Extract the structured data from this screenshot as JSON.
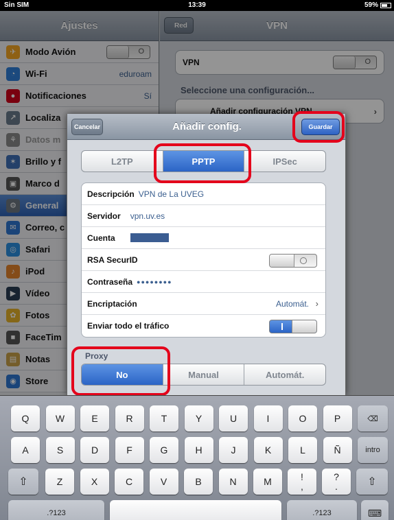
{
  "status_bar": {
    "carrier": "Sin SIM",
    "time": "13:39",
    "battery": "59%"
  },
  "master": {
    "title": "Ajustes",
    "items": [
      {
        "label": "Modo Avión",
        "icon": "airplane-icon",
        "color": "#f5a623",
        "toggle": "O"
      },
      {
        "label": "Wi-Fi",
        "icon": "wifi-icon",
        "color": "#2f7fd8",
        "value": "eduroam"
      },
      {
        "label": "Notificaciones",
        "icon": "notifications-icon",
        "color": "#d0021b",
        "value": "Sí"
      },
      {
        "label": "Localiza",
        "icon": "location-icon",
        "color": "#6a7b8c"
      },
      {
        "label": "Datos m",
        "icon": "data-icon",
        "color": "#8a8a8a"
      },
      {
        "label": "Brillo y f",
        "icon": "brightness-icon",
        "color": "#3f6fb6"
      },
      {
        "label": "Marco d",
        "icon": "picture-frame-icon",
        "color": "#555"
      },
      {
        "label": "General",
        "icon": "gear-icon",
        "color": "#6d7882"
      },
      {
        "label": "Correo, c",
        "icon": "mail-icon",
        "color": "#2e76d0"
      },
      {
        "label": "Safari",
        "icon": "compass-icon",
        "color": "#2b8fe0"
      },
      {
        "label": "iPod",
        "icon": "music-icon",
        "color": "#e3842b"
      },
      {
        "label": "Vídeo",
        "icon": "video-icon",
        "color": "#2a3d54"
      },
      {
        "label": "Fotos",
        "icon": "flower-icon",
        "color": "#e5b22a"
      },
      {
        "label": "FaceTim",
        "icon": "facetime-icon",
        "color": "#555"
      },
      {
        "label": "Notas",
        "icon": "notes-icon",
        "color": "#c9a049"
      },
      {
        "label": "Store",
        "icon": "store-icon",
        "color": "#2e76d0"
      }
    ]
  },
  "detail": {
    "back": "Red",
    "title": "VPN",
    "vpn_label": "VPN",
    "vpn_toggle": "O",
    "section": "Seleccione una configuración...",
    "add_config": "Añadir configuración VPN..."
  },
  "sheet": {
    "title": "Añadir config.",
    "cancel": "Cancelar",
    "save": "Guardar",
    "protocol_tabs": [
      "L2TP",
      "PPTP",
      "IPSec"
    ],
    "selected_protocol": "PPTP",
    "fields": {
      "description_label": "Descripción",
      "description_value": "VPN de La UVEG",
      "server_label": "Servidor",
      "server_value": "vpn.uv.es",
      "account_label": "Cuenta",
      "rsa_label": "RSA SecurID",
      "password_label": "Contraseña",
      "password_value": "●●●●●●●●",
      "encryption_label": "Encriptación",
      "encryption_value": "Automát.",
      "send_all_label": "Enviar todo el tráfico"
    },
    "proxy_label": "Proxy",
    "proxy_options": [
      "No",
      "Manual",
      "Automát."
    ],
    "selected_proxy": "No"
  },
  "keyboard": {
    "row1": [
      "Q",
      "W",
      "E",
      "R",
      "T",
      "Y",
      "U",
      "I",
      "O",
      "P"
    ],
    "row2": [
      "A",
      "S",
      "D",
      "F",
      "G",
      "H",
      "J",
      "K",
      "L",
      "Ñ"
    ],
    "row3": [
      "Z",
      "X",
      "C",
      "V",
      "B",
      "N",
      "M"
    ],
    "return": "intro",
    "numbers": ".?123",
    "punct1_top": "!",
    "punct1_bottom": ",",
    "punct2_top": "?",
    "punct2_bottom": "."
  },
  "colors": {
    "accent": "#2b64c6",
    "highlight": "#e4001b"
  }
}
